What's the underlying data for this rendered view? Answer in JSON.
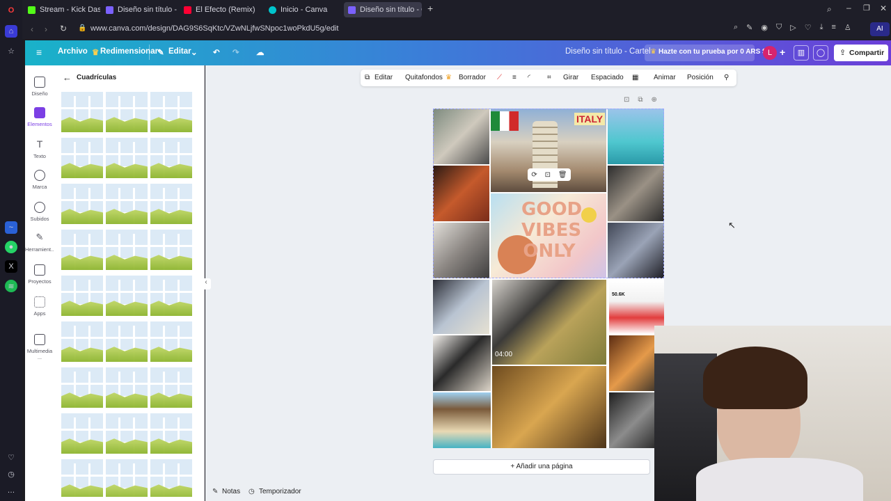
{
  "browser": {
    "tabs": [
      {
        "label": "Stream - Kick Dashboard",
        "color": "#53fc18"
      },
      {
        "label": "Diseño sin título - Flyer (A",
        "color": "#7b61ff"
      },
      {
        "label": "El Efecto (Remix) - You",
        "color": "#ff0033"
      },
      {
        "label": "Inicio - Canva",
        "color": "#00c4cc"
      },
      {
        "label": "Diseño sin título - Cartel",
        "color": "#7b61ff"
      }
    ],
    "url": "www.canva.com/design/DAG9S6SqKtc/VZwNLjfwSNpoc1woPkdU5g/edit",
    "ai_label": "AI"
  },
  "canva": {
    "menu": {
      "archivo": "Archivo",
      "redimensionar": "Redimensionar",
      "editar": "Editar"
    },
    "doc_title": "Diseño sin título - Cartel",
    "trial": "Hazte con tu prueba por 0 ARS $",
    "avatar_letter": "L",
    "share": "Compartir",
    "rail": [
      "Diseño",
      "Elementos",
      "Texto",
      "Marca",
      "Subidos",
      "Herramient...",
      "Proyectos",
      "Apps",
      "Multimedia ..."
    ],
    "panel_title": "Cuadrículas",
    "context_bar": [
      "Editar",
      "Quitafondos",
      "Borrador",
      "Girar",
      "Espaciado",
      "Animar",
      "Posición"
    ],
    "add_page": "+ Añadir una página",
    "notes": "Notas",
    "timer": "Temporizador",
    "design_text": {
      "italy": "ITALY",
      "vibes": [
        "GOOD",
        "VIBES",
        "ONLY"
      ],
      "time": "04:00",
      "followers": "50.6K"
    }
  },
  "colors": {
    "accent": "#8b3dff",
    "avatar": "#d6246e"
  }
}
